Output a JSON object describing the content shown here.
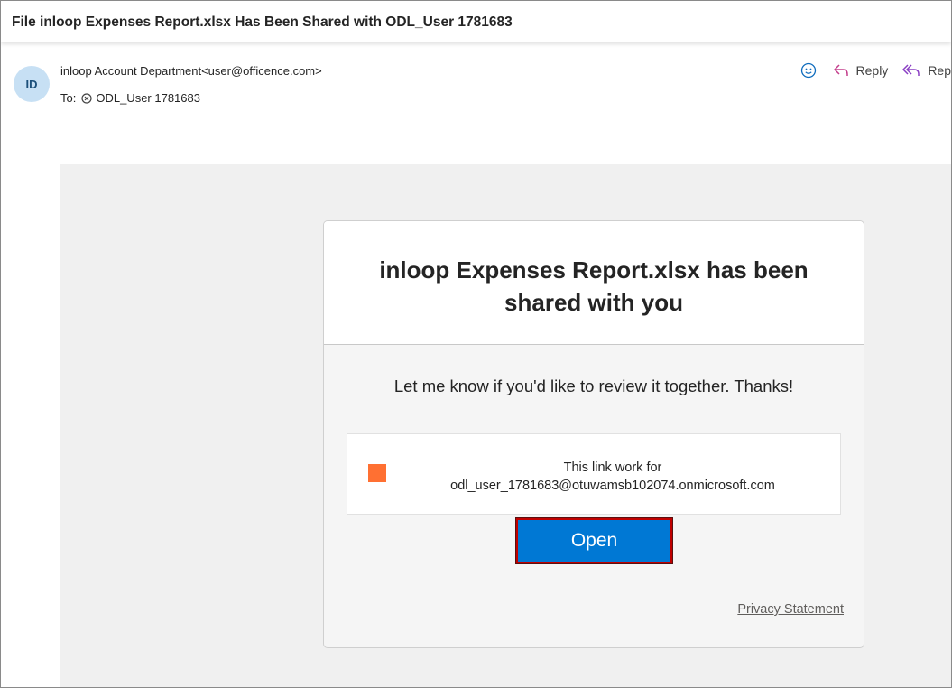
{
  "email": {
    "subject": "File inloop Expenses Report.xlsx Has Been Shared with ODL_User 1781683",
    "avatar_initials": "ID",
    "from": "inloop Account Department<user@officence.com>",
    "to_label": "To:",
    "to_recipient": "ODL_User 1781683"
  },
  "actions": {
    "emoji_icon": "smiley-icon",
    "reply_label": "Reply",
    "reply_all_label": "Rep"
  },
  "share_card": {
    "title": "inloop Expenses Report.xlsx has been shared with you",
    "message": "Let me know if you'd like to review it together. Thanks!",
    "link_line1": "This link work for",
    "link_line2": "odl_user_1781683@otuwamsb102074.onmicrosoft.com",
    "open_label": "Open",
    "privacy_label": "Privacy Statement"
  },
  "colors": {
    "accent": "#0078d4",
    "avatar_bg": "#c7e0f4",
    "file_icon": "#ff7032",
    "highlight_border": "#c00000"
  }
}
